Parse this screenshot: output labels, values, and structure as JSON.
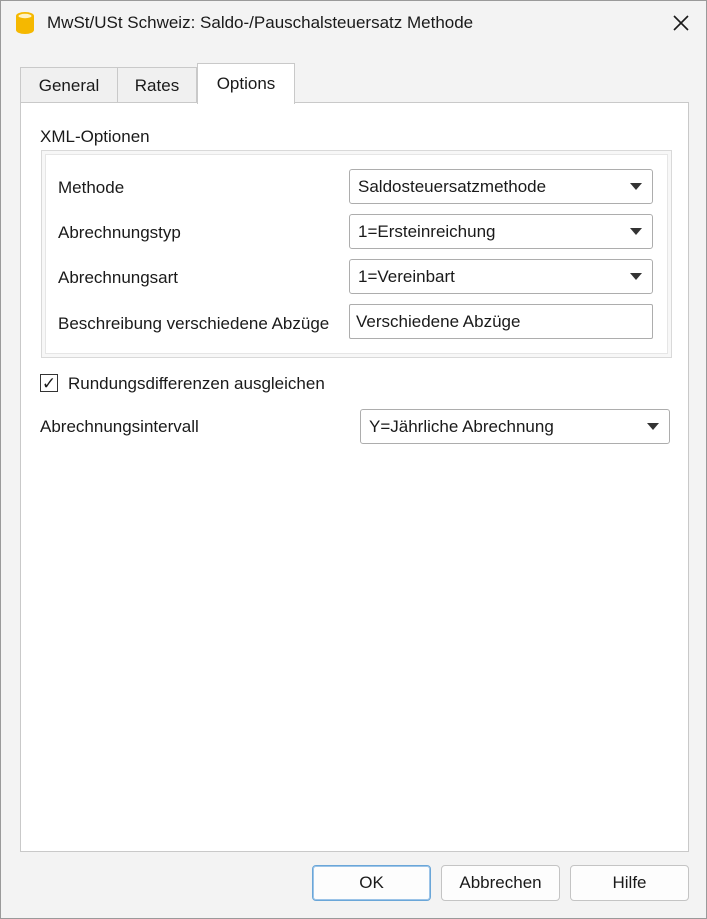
{
  "window": {
    "title": "MwSt/USt Schweiz: Saldo-/Pauschalsteuersatz Methode"
  },
  "tabs": [
    {
      "label": "General",
      "active": false
    },
    {
      "label": "Rates",
      "active": false
    },
    {
      "label": "Options",
      "active": true
    }
  ],
  "xml_options": {
    "title": "XML-Optionen",
    "methode": {
      "label": "Methode",
      "value": "Saldosteuersatzmethode"
    },
    "abrechnungstyp": {
      "label": "Abrechnungstyp",
      "value": "1=Ersteinreichung"
    },
    "abrechnungsart": {
      "label": "Abrechnungsart",
      "value": "1=Vereinbart"
    },
    "beschreibung": {
      "label": "Beschreibung verschiedene Abzüge",
      "value": "Verschiedene Abzüge"
    }
  },
  "rundung": {
    "label": "Rundungsdifferenzen ausgleichen",
    "checked": true,
    "check_glyph": "✓"
  },
  "intervall": {
    "label": "Abrechnungsintervall",
    "value": "Y=Jährliche Abrechnung"
  },
  "buttons": {
    "ok": "OK",
    "cancel": "Abbrechen",
    "help": "Hilfe"
  },
  "icons": {
    "app": "app-database-icon",
    "close": "close-icon",
    "dropdown": "chevron-down-icon"
  },
  "colors": {
    "app_icon": "#f5b800",
    "default_button_border": "#6aa6d8"
  }
}
